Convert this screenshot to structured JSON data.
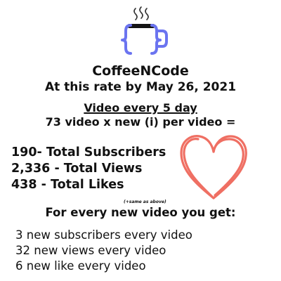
{
  "brand": "CoffeeNCode",
  "rate_line": "At this rate by May 26, 2021",
  "cadence": "Video every 5 day",
  "formula": "73 video x new (i) per video =",
  "totals": [
    "190- Total Subscribers",
    "2,336  - Total Views",
    "438 - Total Likes"
  ],
  "note": "(+same as above)",
  "every_heading": "For every new video you get:",
  "per_video": [
    "3 new subscribers every video",
    "32 new views every video",
    "6 new like every video"
  ],
  "colors": {
    "logo": "#6b74f0",
    "heart": "#ef6f63",
    "text": "#111111"
  },
  "icons": [
    "coffee-mug-code-logo-icon",
    "heart-doodle-icon"
  ]
}
